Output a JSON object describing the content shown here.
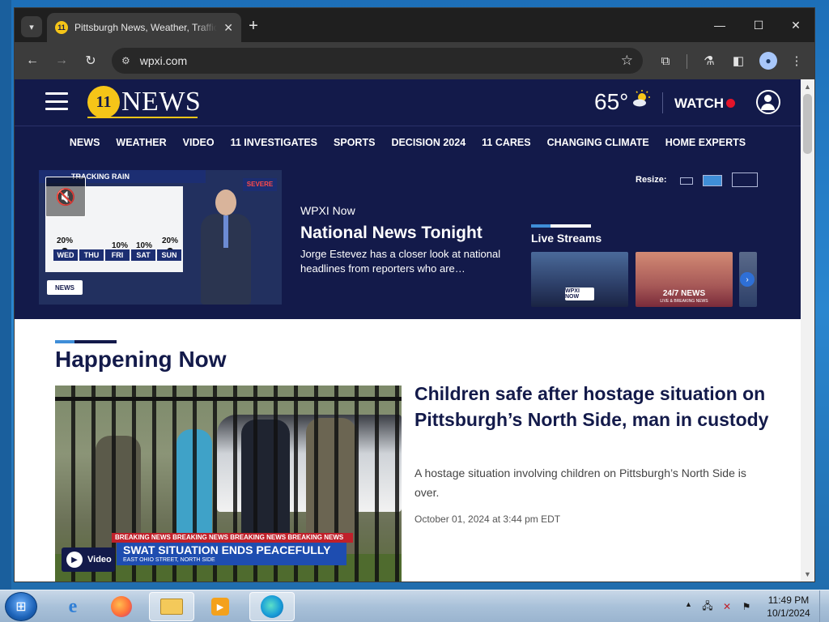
{
  "browser": {
    "tab_title": "Pittsburgh News, Weather, Traffic",
    "tab_favicon": "11",
    "url": "wpxi.com",
    "controls": {
      "tab_search": "▾",
      "close_tab": "✕",
      "new_tab": "+",
      "minimize": "—",
      "maximize": "☐",
      "close": "✕",
      "back": "←",
      "forward": "→",
      "reload": "↻",
      "site_info": "⚙",
      "bookmark": "☆",
      "extensions": "⧉",
      "labs": "⚗",
      "side_panel": "◧",
      "profile": "●",
      "menu": "⋮"
    }
  },
  "site": {
    "logo_mark": "11",
    "logo_text": "NEWS",
    "weather": {
      "temperature": "65°",
      "icon": "partly-sunny-icon"
    },
    "watch_label": "WATCH",
    "nav": [
      "NEWS",
      "WEATHER",
      "VIDEO",
      "11 INVESTIGATES",
      "SPORTS",
      "DECISION 2024",
      "11 CARES",
      "CHANGING CLIMATE",
      "HOME EXPERTS"
    ],
    "promo": {
      "player": {
        "board_title": "TRACKING RAIN",
        "severe_label": "SEVERE",
        "forecast": [
          {
            "day": "WED",
            "pct": "20%"
          },
          {
            "day": "THU",
            "pct": ""
          },
          {
            "day": "FRI",
            "pct": "10%"
          },
          {
            "day": "SAT",
            "pct": "10%"
          },
          {
            "day": "SUN",
            "pct": "20%"
          }
        ],
        "channel_logo": "NEWS",
        "mute_icon": "🔇"
      },
      "eyebrow": "WPXI Now",
      "title": "National News Tonight",
      "description": "Jorge Estevez has a closer look at national headlines from reporters who are…",
      "resize_label": "Resize:",
      "live_streams": {
        "title": "Live Streams",
        "card1_badge": "WPXI NOW",
        "card2_title": "24/7 NEWS",
        "card2_sub": "LIVE & BREAKING NEWS",
        "next_arrow": "›"
      }
    },
    "happening_now": {
      "title": "Happening Now",
      "story": {
        "headline": "Children safe after hostage situation on Pittsburgh’s North Side, man in custody",
        "summary": "A hostage situation involving children on Pittsburgh’s North Side is over.",
        "date": "October 01, 2024 at 3:44 pm EDT",
        "video": {
          "label": "Video",
          "ticker": "BREAKING NEWS     BREAKING NEWS     BREAKING NEWS     BREAKING NEWS",
          "headline": "SWAT SITUATION ENDS PEACEFULLY",
          "subline": "EAST OHIO STREET, NORTH SIDE"
        }
      }
    }
  },
  "taskbar": {
    "start_icon": "⊞",
    "ie_icon": "e",
    "clock_time": "11:49 PM",
    "clock_date": "10/1/2024",
    "tray_arrow": "▲"
  }
}
